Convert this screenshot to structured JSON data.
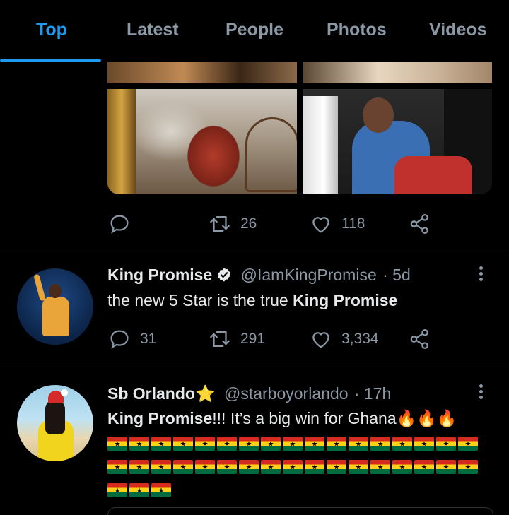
{
  "tabs": [
    {
      "label": "Top",
      "active": true
    },
    {
      "label": "Latest",
      "active": false
    },
    {
      "label": "People",
      "active": false
    },
    {
      "label": "Photos",
      "active": false
    },
    {
      "label": "Videos",
      "active": false
    }
  ],
  "colors": {
    "accent": "#1d9bf0",
    "muted": "#8b98a5",
    "background": "#000000",
    "text": "#e7e9ea"
  },
  "first_tweet_actions": {
    "replies": "",
    "retweets": "26",
    "likes": "118"
  },
  "tweets": [
    {
      "name": "King Promise",
      "verified": true,
      "handle": "@IamKingPromise",
      "time": "· 5d",
      "text_plain": "the new 5 Star is the true ",
      "text_bold": "King Promise",
      "replies": "31",
      "retweets": "291",
      "likes": "3,334"
    },
    {
      "name": "Sb Orlando",
      "name_emoji": "⭐",
      "handle": "@starboyorlando",
      "time": "· 17h",
      "text_bold": "King Promise",
      "text_plain": "!!! It’s a big win for Ghana",
      "fire_emojis": "🔥🔥🔥",
      "flag_rows": [
        17,
        17,
        3
      ]
    }
  ],
  "icons": [
    "reply-icon",
    "retweet-icon",
    "like-icon",
    "share-icon",
    "more-icon",
    "verified-icon",
    "star-emoji",
    "fire-emoji",
    "ghana-flag-emoji"
  ]
}
